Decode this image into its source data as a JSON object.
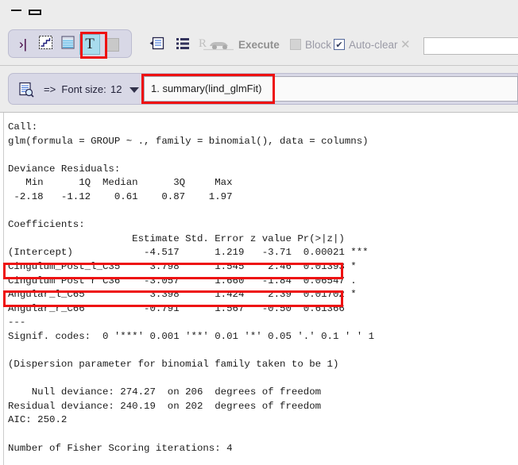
{
  "window": {
    "minimize_label": "minimize",
    "maximize_label": "maximize"
  },
  "toolbar": {
    "tabs": [
      {
        "name": "script-tab",
        "glyph": "›|"
      },
      {
        "name": "plot-tab",
        "glyph": "plot"
      },
      {
        "name": "table-tab",
        "glyph": "table"
      },
      {
        "name": "text-tab",
        "glyph": "T",
        "selected": true
      },
      {
        "name": "blank-tab",
        "glyph": ""
      }
    ],
    "indent_icon": "indent-icon",
    "list_icon": "list-icon",
    "execute_label": "Execute",
    "block_label": "Block",
    "block_checked": false,
    "autoclear_label": "Auto-clear",
    "autoclear_checked": true,
    "autoclear_check_glyph": "✔",
    "close_label": "✕",
    "search_value": "",
    "search_placeholder": ""
  },
  "subbar": {
    "doc_icon": "document-search-icon",
    "font_size_label": "=>  Font size:",
    "font_size_value": "12",
    "dropdown_icon": "chevron-down-icon",
    "command_value": "1. summary(lind_glmFit)",
    "command_placeholder": ""
  },
  "console": {
    "text": "Call:\nglm(formula = GROUP ~ ., family = binomial(), data = columns)\n\nDeviance Residuals:\n   Min      1Q  Median      3Q     Max\n -2.18   -1.12    0.61    0.87    1.97\n\nCoefficients:\n                     Estimate Std. Error z value Pr(>|z|)\n(Intercept)            -4.517      1.219   -3.71  0.00021 ***\nCingulum_Post_l_C35     3.798      1.545    2.46  0.01393 *\nCingulum Post r C36    -3.057      1.660   -1.84  0.06547 .\nAngular_l_C65           3.398      1.424    2.39  0.01702 *\nAngular_r_C66          -0.791      1.567   -0.50  0.61366\n---\nSignif. codes:  0 '***' 0.001 '**' 0.01 '*' 0.05 '.' 0.1 ' ' 1\n\n(Dispersion parameter for binomial family taken to be 1)\n\n    Null deviance: 274.27  on 206  degrees of freedom\nResidual deviance: 240.19  on 202  degrees of freedom\nAIC: 250.2\n\nNumber of Fisher Scoring iterations: 4\n"
  },
  "annotations": {
    "highlight_color": "#ee1111",
    "boxes": [
      {
        "name": "text-tab-highlight",
        "target": "text-tab"
      },
      {
        "name": "command-field-highlight",
        "target": "command-combo"
      },
      {
        "name": "coefficient-row-highlight-1",
        "target": "Cingulum_Post_l_C35"
      },
      {
        "name": "coefficient-row-highlight-2",
        "target": "Angular_l_C65"
      }
    ]
  }
}
